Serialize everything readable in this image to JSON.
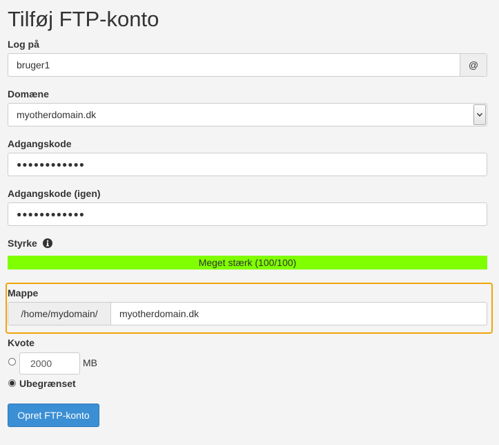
{
  "page": {
    "title": "Tilføj FTP-konto"
  },
  "login": {
    "label": "Log på",
    "value": "bruger1",
    "addon": "@"
  },
  "domain": {
    "label": "Domæne",
    "selected": "myotherdomain.dk"
  },
  "password": {
    "label": "Adgangskode",
    "masked": "●●●●●●●●●●●●"
  },
  "password_again": {
    "label": "Adgangskode (igen)",
    "masked": "●●●●●●●●●●●●"
  },
  "strength": {
    "label": "Styrke",
    "bar_text": "Meget stærk (100/100)",
    "score": 100,
    "max": 100,
    "bar_color": "#7fff00",
    "icon": "info-circle-icon"
  },
  "directory": {
    "label": "Mappe",
    "prefix": "/home/mydomain/",
    "value": "myotherdomain.dk",
    "highlight_color": "#f0a30a"
  },
  "quota": {
    "label": "Kvote",
    "limited_value": "2000",
    "unit": "MB",
    "unlimited_label": "Ubegrænset",
    "selected": "unlimited"
  },
  "actions": {
    "submit_label": "Opret FTP-konto",
    "submit_color": "#3b8fd4"
  }
}
